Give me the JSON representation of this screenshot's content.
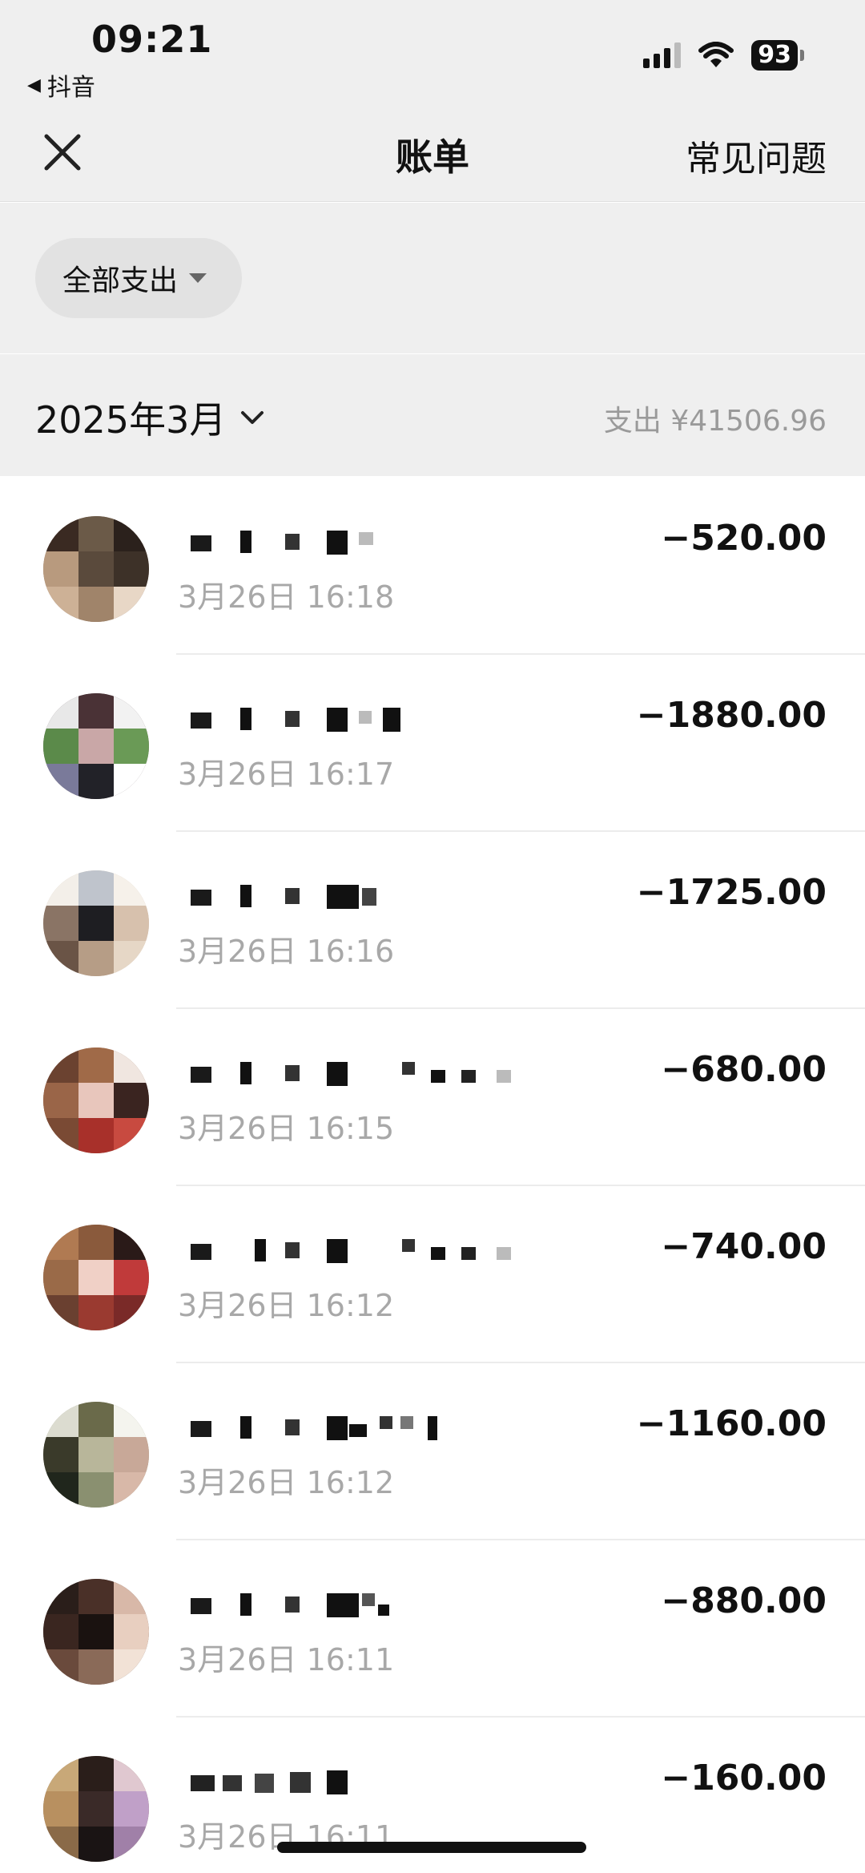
{
  "status": {
    "time": "09:21",
    "back_app": "抖音",
    "battery": "93"
  },
  "nav": {
    "title": "账单",
    "faq": "常见问题"
  },
  "filter": {
    "label": "全部支出"
  },
  "month": {
    "label": "2025年3月",
    "total": "支出 ¥41506.96"
  },
  "transactions": [
    {
      "time": "3月26日 16:18",
      "amount": "−520.00"
    },
    {
      "time": "3月26日 16:17",
      "amount": "−1880.00"
    },
    {
      "time": "3月26日 16:16",
      "amount": "−1725.00"
    },
    {
      "time": "3月26日 16:15",
      "amount": "−680.00"
    },
    {
      "time": "3月26日 16:12",
      "amount": "−740.00"
    },
    {
      "time": "3月26日 16:12",
      "amount": "−1160.00"
    },
    {
      "time": "3月26日 16:11",
      "amount": "−880.00"
    },
    {
      "time": "3月26日 16:11",
      "amount": "−160.00"
    }
  ],
  "colors": {
    "header_bg": "#efefef",
    "muted_text": "#a8a8a8"
  }
}
